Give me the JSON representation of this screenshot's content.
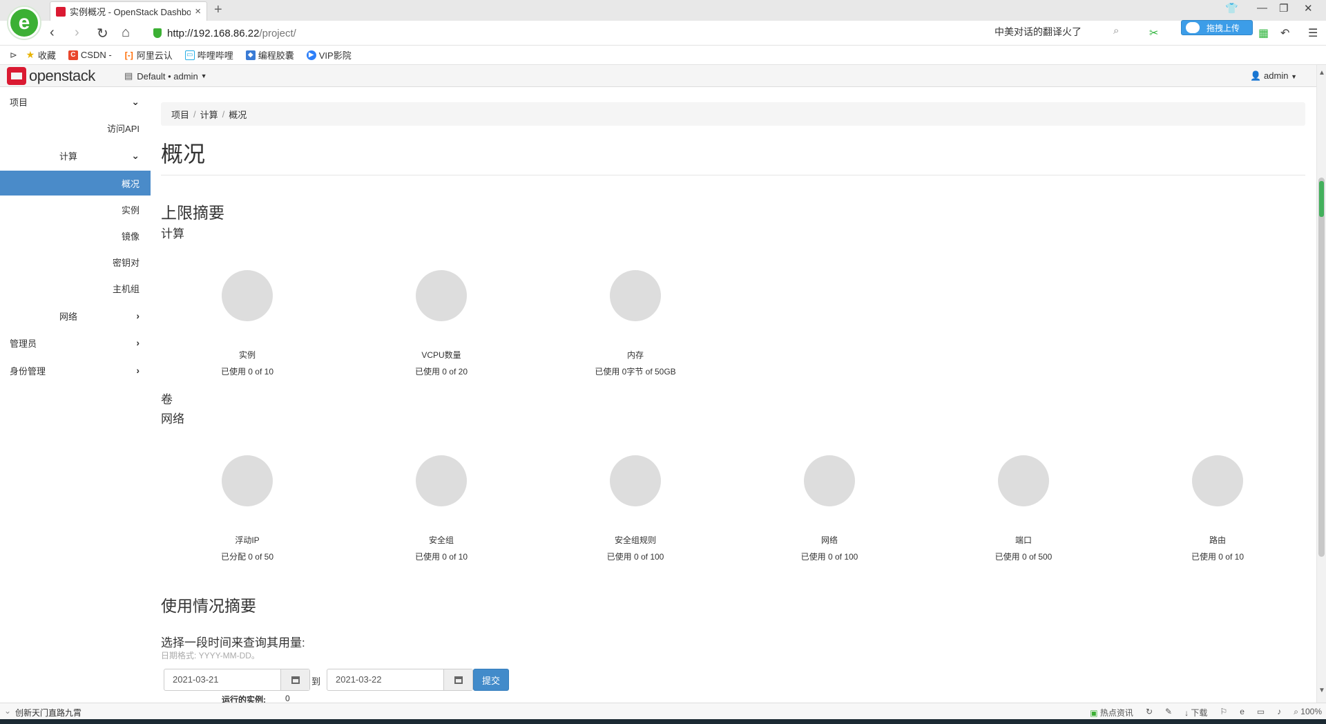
{
  "browser": {
    "tab_title": "实例概况 - OpenStack Dashboard",
    "url_host": "http://192.168.86.22",
    "url_path": "/project/",
    "search_text": "中美对话的翻译火了",
    "upload_label": "拖拽上传",
    "bookmarks": [
      "收藏",
      "CSDN -",
      "阿里云认",
      "哔哩哔哩",
      "编程胶囊",
      "VIP影院"
    ]
  },
  "header": {
    "logo_text": "openstack",
    "project": "Default • admin",
    "user": "admin"
  },
  "sidebar": {
    "project": "项目",
    "api_access": "访问API",
    "compute": "计算",
    "overview": "概况",
    "instances": "实例",
    "images": "镜像",
    "keypairs": "密钥对",
    "server_groups": "主机组",
    "network": "网络",
    "admin": "管理员",
    "identity": "身份管理"
  },
  "breadcrumb": [
    "项目",
    "计算",
    "概况"
  ],
  "page_title": "概况",
  "limits": {
    "heading": "上限摘要",
    "compute_heading": "计算",
    "compute": [
      {
        "label": "实例",
        "usage": "已使用 0 of 10"
      },
      {
        "label": "VCPU数量",
        "usage": "已使用 0 of 20"
      },
      {
        "label": "内存",
        "usage": "已使用 0字节 of 50GB"
      }
    ],
    "volume_heading": "卷",
    "network_heading": "网络",
    "network": [
      {
        "label": "浮动IP",
        "usage": "已分配 0 of 50"
      },
      {
        "label": "安全组",
        "usage": "已使用 0 of 10"
      },
      {
        "label": "安全组规则",
        "usage": "已使用 0 of 100"
      },
      {
        "label": "网络",
        "usage": "已使用 0 of 100"
      },
      {
        "label": "端口",
        "usage": "已使用 0 of 500"
      },
      {
        "label": "路由",
        "usage": "已使用 0 of 10"
      }
    ]
  },
  "usage": {
    "heading": "使用情况摘要",
    "intro": "选择一段时间来查询其用量:",
    "hint": "日期格式: YYYY-MM-DD。",
    "start_date": "2021-03-21",
    "to": "到",
    "end_date": "2021-03-22",
    "submit": "提交",
    "running_label": "运行的实例:",
    "running_value": "0"
  },
  "statusbar": {
    "news": "创新天门直路九霄",
    "hot": "热点资讯",
    "download": "下载",
    "zoom": "100%"
  }
}
